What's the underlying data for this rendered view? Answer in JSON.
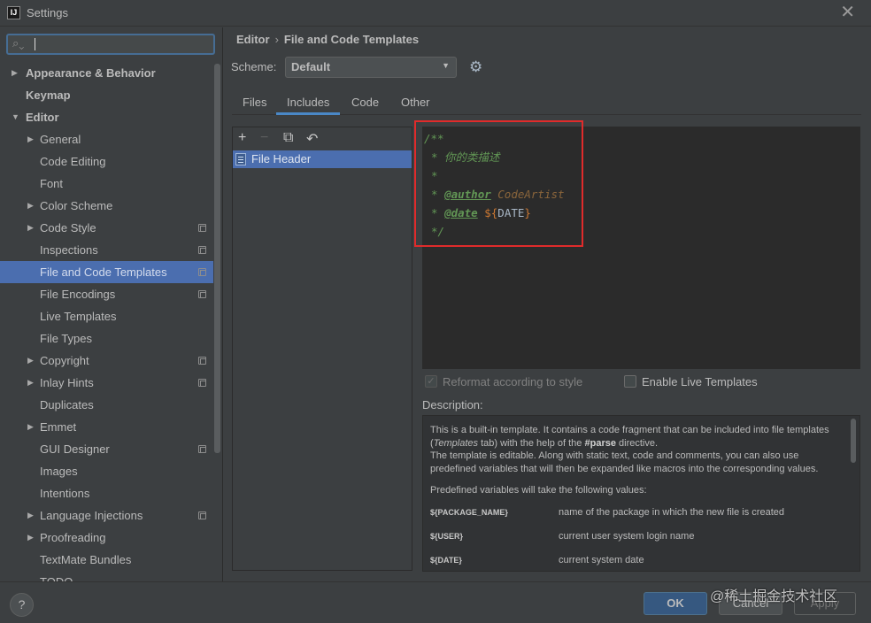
{
  "window": {
    "icon_text": "IJ",
    "title": "Settings",
    "close": "✕"
  },
  "sidebar": {
    "search_value": "",
    "items": [
      {
        "label": "Appearance & Behavior",
        "arrow": "▶",
        "bold": true,
        "depth": 0,
        "cfg": false,
        "selected": false
      },
      {
        "label": "Keymap",
        "arrow": "",
        "bold": true,
        "depth": 0,
        "cfg": false,
        "selected": false
      },
      {
        "label": "Editor",
        "arrow": "▼",
        "bold": true,
        "depth": 0,
        "cfg": false,
        "selected": false
      },
      {
        "label": "General",
        "arrow": "▶",
        "bold": false,
        "depth": 1,
        "cfg": false,
        "selected": false
      },
      {
        "label": "Code Editing",
        "arrow": "",
        "bold": false,
        "depth": 1,
        "cfg": false,
        "selected": false
      },
      {
        "label": "Font",
        "arrow": "",
        "bold": false,
        "depth": 1,
        "cfg": false,
        "selected": false
      },
      {
        "label": "Color Scheme",
        "arrow": "▶",
        "bold": false,
        "depth": 1,
        "cfg": false,
        "selected": false
      },
      {
        "label": "Code Style",
        "arrow": "▶",
        "bold": false,
        "depth": 1,
        "cfg": true,
        "selected": false
      },
      {
        "label": "Inspections",
        "arrow": "",
        "bold": false,
        "depth": 1,
        "cfg": true,
        "selected": false
      },
      {
        "label": "File and Code Templates",
        "arrow": "",
        "bold": false,
        "depth": 1,
        "cfg": true,
        "selected": true
      },
      {
        "label": "File Encodings",
        "arrow": "",
        "bold": false,
        "depth": 1,
        "cfg": true,
        "selected": false
      },
      {
        "label": "Live Templates",
        "arrow": "",
        "bold": false,
        "depth": 1,
        "cfg": false,
        "selected": false
      },
      {
        "label": "File Types",
        "arrow": "",
        "bold": false,
        "depth": 1,
        "cfg": false,
        "selected": false
      },
      {
        "label": "Copyright",
        "arrow": "▶",
        "bold": false,
        "depth": 1,
        "cfg": true,
        "selected": false
      },
      {
        "label": "Inlay Hints",
        "arrow": "▶",
        "bold": false,
        "depth": 1,
        "cfg": true,
        "selected": false
      },
      {
        "label": "Duplicates",
        "arrow": "",
        "bold": false,
        "depth": 1,
        "cfg": false,
        "selected": false
      },
      {
        "label": "Emmet",
        "arrow": "▶",
        "bold": false,
        "depth": 1,
        "cfg": false,
        "selected": false
      },
      {
        "label": "GUI Designer",
        "arrow": "",
        "bold": false,
        "depth": 1,
        "cfg": true,
        "selected": false
      },
      {
        "label": "Images",
        "arrow": "",
        "bold": false,
        "depth": 1,
        "cfg": false,
        "selected": false
      },
      {
        "label": "Intentions",
        "arrow": "",
        "bold": false,
        "depth": 1,
        "cfg": false,
        "selected": false
      },
      {
        "label": "Language Injections",
        "arrow": "▶",
        "bold": false,
        "depth": 1,
        "cfg": true,
        "selected": false
      },
      {
        "label": "Proofreading",
        "arrow": "▶",
        "bold": false,
        "depth": 1,
        "cfg": false,
        "selected": false
      },
      {
        "label": "TextMate Bundles",
        "arrow": "",
        "bold": false,
        "depth": 1,
        "cfg": false,
        "selected": false
      },
      {
        "label": "TODO",
        "arrow": "",
        "bold": false,
        "depth": 1,
        "cfg": false,
        "selected": false
      }
    ]
  },
  "breadcrumb": {
    "parent": "Editor",
    "sep": "›",
    "current": "File and Code Templates"
  },
  "scheme": {
    "label": "Scheme:",
    "value": "Default"
  },
  "tabs": [
    "Files",
    "Includes",
    "Code",
    "Other"
  ],
  "active_tab": "Includes",
  "template_list": {
    "toolbar": [
      "+",
      "−",
      "⧉",
      "↶"
    ],
    "items": [
      "File Header"
    ]
  },
  "editor": {
    "l1": "/**",
    "l2": "* 你的类描述",
    "l3": "*",
    "l4_prefix": "* ",
    "l4_tag": "@author",
    "l4_val": " CodeArtist",
    "l5_prefix": "* ",
    "l5_tag": "@date",
    "l5_sp": " ",
    "l5_dollar": "${",
    "l5_var": "DATE",
    "l5_close": "}",
    "l6": "*/"
  },
  "options": {
    "reformat": "Reformat according to style",
    "live": "Enable Live Templates",
    "reformat_checked": true,
    "live_checked": false
  },
  "description": {
    "label": "Description:",
    "p1a": "This is a built-in template. It contains a code fragment that can be included into file templates (",
    "p1i": "Templates",
    "p1b": " tab) with the help of the ",
    "p1k": "#parse",
    "p1c": " directive.",
    "p2": "The template is editable. Along with static text, code and comments, you can also use predefined variables that will then be expanded like macros into the corresponding values.",
    "p3": "Predefined variables will take the following values:",
    "vars": [
      {
        "name": "${PACKAGE_NAME}",
        "desc": "name of the package in which the new file is created"
      },
      {
        "name": "${USER}",
        "desc": "current user system login name"
      },
      {
        "name": "${DATE}",
        "desc": "current system date"
      }
    ]
  },
  "buttons": {
    "help": "?",
    "ok": "OK",
    "cancel": "Cancel",
    "apply": "Apply"
  },
  "watermark": "@稀土掘金技术社区"
}
